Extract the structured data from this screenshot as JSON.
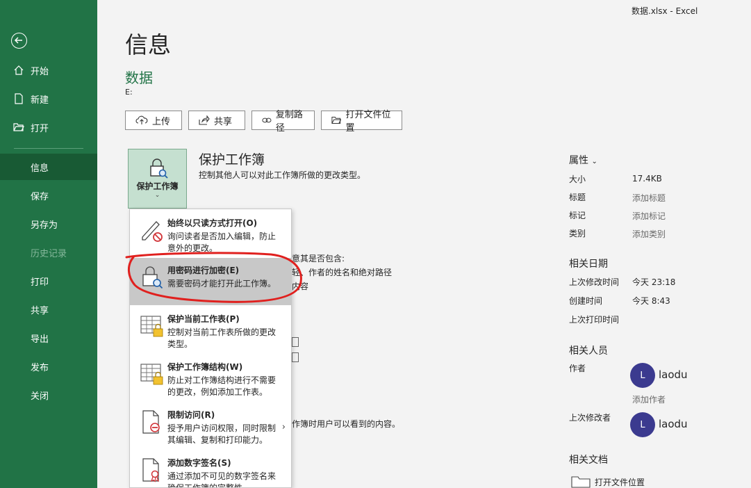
{
  "window": {
    "title": "数据.xlsx  -  Excel"
  },
  "sidebar": {
    "items": [
      {
        "label": "开始"
      },
      {
        "label": "新建"
      },
      {
        "label": "打开"
      },
      {
        "label": "信息"
      },
      {
        "label": "保存"
      },
      {
        "label": "另存为"
      },
      {
        "label": "历史记录"
      },
      {
        "label": "打印"
      },
      {
        "label": "共享"
      },
      {
        "label": "导出"
      },
      {
        "label": "发布"
      },
      {
        "label": "关闭"
      }
    ]
  },
  "main": {
    "title": "信息",
    "doc_name": "数据",
    "doc_path": "E:",
    "buttons": [
      {
        "label": "上传"
      },
      {
        "label": "共享"
      },
      {
        "label": "复制路径"
      },
      {
        "label": "打开文件位置"
      }
    ],
    "protect": {
      "tile_label": "保护工作簿",
      "heading": "保护工作簿",
      "description": "控制其他人可以对此工作簿所做的更改类型。"
    },
    "background_texts": [
      "意其是否包含:",
      "轻、作者的姓名和绝对路径",
      "内容",
      "作簿时用户可以看到的内容。"
    ]
  },
  "menu": {
    "items": [
      {
        "title": "始终以只读方式打开(O)",
        "desc": "询问读者是否加入编辑，防止意外的更改。"
      },
      {
        "title": "用密码进行加密(E)",
        "desc": "需要密码才能打开此工作簿。"
      },
      {
        "title": "保护当前工作表(P)",
        "desc": "控制对当前工作表所做的更改类型。"
      },
      {
        "title": "保护工作簿结构(W)",
        "desc": "防止对工作簿结构进行不需要的更改，例如添加工作表。"
      },
      {
        "title": "限制访问(R)",
        "desc": "授予用户访问权限，同时限制其编辑、复制和打印能力。"
      },
      {
        "title": "添加数字签名(S)",
        "desc": "通过添加不可见的数字签名来确保工作簿的完整性"
      }
    ]
  },
  "properties": {
    "title": "属性",
    "rows": [
      {
        "label": "大小",
        "value": "17.4KB"
      },
      {
        "label": "标题",
        "value": "添加标题"
      },
      {
        "label": "标记",
        "value": "添加标记"
      },
      {
        "label": "类别",
        "value": "添加类别"
      }
    ]
  },
  "dates": {
    "title": "相关日期",
    "rows": [
      {
        "label": "上次修改时间",
        "value": "今天 23:18"
      },
      {
        "label": "创建时间",
        "value": "今天 8:43"
      },
      {
        "label": "上次打印时间",
        "value": ""
      }
    ]
  },
  "people": {
    "title": "相关人员",
    "author_label": "作者",
    "author_initial": "L",
    "author_name": "laodu",
    "add_author": "添加作者",
    "modifier_label": "上次修改者",
    "modifier_initial": "L",
    "modifier_name": "laodu"
  },
  "docs": {
    "title": "相关文档",
    "open_location": "打开文件位置"
  },
  "colors": {
    "sidebar": "#217346",
    "sidebar_active": "#185a34",
    "accent_green": "#217346",
    "annotation": "#e0201e",
    "avatar": "#3b3a8f"
  }
}
